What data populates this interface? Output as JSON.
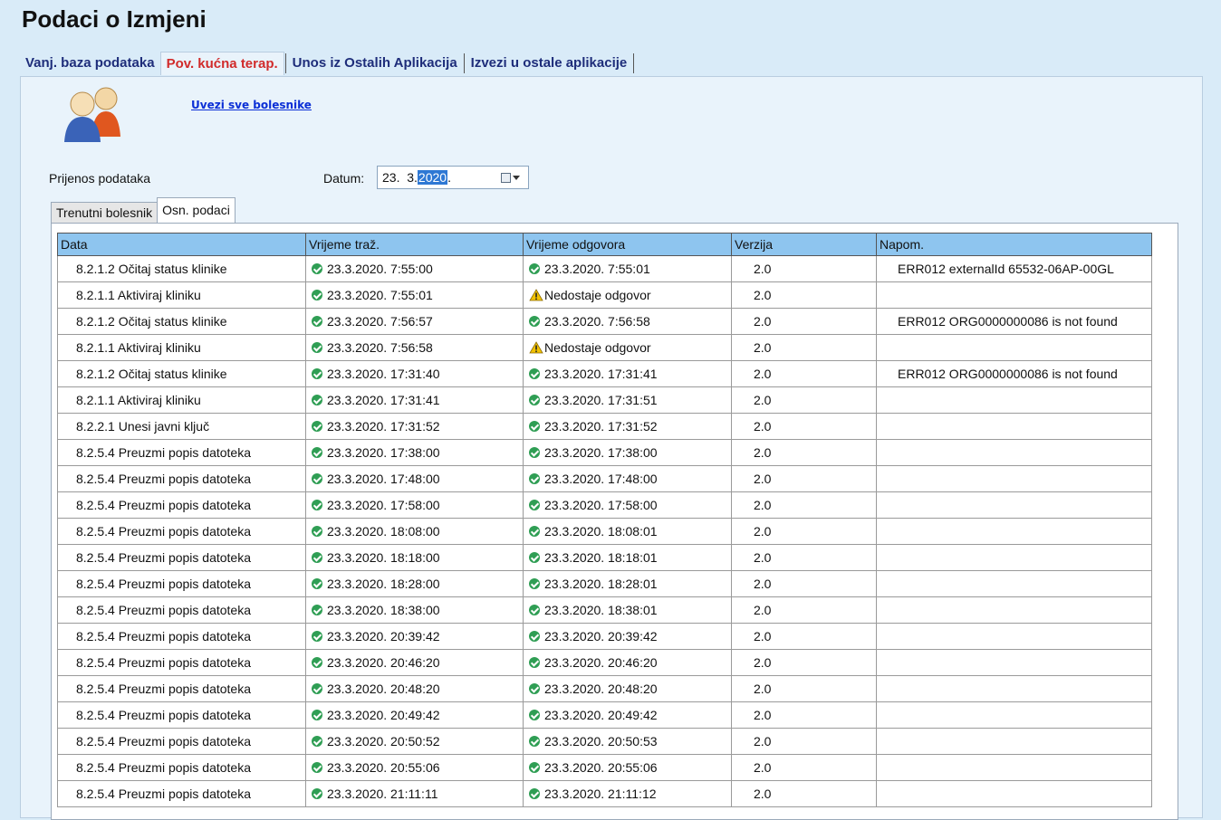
{
  "page": {
    "title": "Podaci o Izmjeni"
  },
  "main_tabs": [
    {
      "label": "Vanj. baza podataka",
      "active": false
    },
    {
      "label": "Pov. kućna terap.",
      "active": true
    },
    {
      "label": "Unos iz Ostalih Aplikacija",
      "active": false
    },
    {
      "label": "Izvezi u ostale aplikacije",
      "active": false
    }
  ],
  "panel": {
    "link_label": "Uvezi sve bolesnike",
    "transfer_label": "Prijenos podataka",
    "date_label": "Datum:",
    "date_value": {
      "day_month": "23.  3.",
      "year": "2020",
      "suffix": "."
    }
  },
  "sub_tabs": [
    {
      "label": "Trenutni bolesnik",
      "active": false
    },
    {
      "label": "Osn. podaci",
      "active": true
    }
  ],
  "grid": {
    "columns": [
      "Data",
      "Vrijeme traž.",
      "Vrijeme odgovora",
      "Verzija",
      "Napom."
    ],
    "rows": [
      {
        "data": "8.2.1.2 Očitaj status klinike",
        "req_time": "23.3.2020. 7:55:00",
        "resp_status": "ok",
        "resp_time": "23.3.2020. 7:55:01",
        "version": "2.0",
        "note": "ERR012 externalId 65532-06AP-00GL"
      },
      {
        "data": "8.2.1.1 Aktiviraj kliniku",
        "req_time": "23.3.2020. 7:55:01",
        "resp_status": "warn",
        "resp_time": "Nedostaje odgovor",
        "version": "2.0",
        "note": ""
      },
      {
        "data": "8.2.1.2 Očitaj status klinike",
        "req_time": "23.3.2020. 7:56:57",
        "resp_status": "ok",
        "resp_time": "23.3.2020. 7:56:58",
        "version": "2.0",
        "note": "ERR012 ORG0000000086 is not found"
      },
      {
        "data": "8.2.1.1 Aktiviraj kliniku",
        "req_time": "23.3.2020. 7:56:58",
        "resp_status": "warn",
        "resp_time": "Nedostaje odgovor",
        "version": "2.0",
        "note": ""
      },
      {
        "data": "8.2.1.2 Očitaj status klinike",
        "req_time": "23.3.2020. 17:31:40",
        "resp_status": "ok",
        "resp_time": "23.3.2020. 17:31:41",
        "version": "2.0",
        "note": "ERR012 ORG0000000086 is not found"
      },
      {
        "data": "8.2.1.1 Aktiviraj kliniku",
        "req_time": "23.3.2020. 17:31:41",
        "resp_status": "ok",
        "resp_time": "23.3.2020. 17:31:51",
        "version": "2.0",
        "note": ""
      },
      {
        "data": "8.2.2.1 Unesi javni ključ",
        "req_time": "23.3.2020. 17:31:52",
        "resp_status": "ok",
        "resp_time": "23.3.2020. 17:31:52",
        "version": "2.0",
        "note": ""
      },
      {
        "data": "8.2.5.4 Preuzmi popis datoteka",
        "req_time": "23.3.2020. 17:38:00",
        "resp_status": "ok",
        "resp_time": "23.3.2020. 17:38:00",
        "version": "2.0",
        "note": ""
      },
      {
        "data": "8.2.5.4 Preuzmi popis datoteka",
        "req_time": "23.3.2020. 17:48:00",
        "resp_status": "ok",
        "resp_time": "23.3.2020. 17:48:00",
        "version": "2.0",
        "note": ""
      },
      {
        "data": "8.2.5.4 Preuzmi popis datoteka",
        "req_time": "23.3.2020. 17:58:00",
        "resp_status": "ok",
        "resp_time": "23.3.2020. 17:58:00",
        "version": "2.0",
        "note": ""
      },
      {
        "data": "8.2.5.4 Preuzmi popis datoteka",
        "req_time": "23.3.2020. 18:08:00",
        "resp_status": "ok",
        "resp_time": "23.3.2020. 18:08:01",
        "version": "2.0",
        "note": ""
      },
      {
        "data": "8.2.5.4 Preuzmi popis datoteka",
        "req_time": "23.3.2020. 18:18:00",
        "resp_status": "ok",
        "resp_time": "23.3.2020. 18:18:01",
        "version": "2.0",
        "note": ""
      },
      {
        "data": "8.2.5.4 Preuzmi popis datoteka",
        "req_time": "23.3.2020. 18:28:00",
        "resp_status": "ok",
        "resp_time": "23.3.2020. 18:28:01",
        "version": "2.0",
        "note": ""
      },
      {
        "data": "8.2.5.4 Preuzmi popis datoteka",
        "req_time": "23.3.2020. 18:38:00",
        "resp_status": "ok",
        "resp_time": "23.3.2020. 18:38:01",
        "version": "2.0",
        "note": ""
      },
      {
        "data": "8.2.5.4 Preuzmi popis datoteka",
        "req_time": "23.3.2020. 20:39:42",
        "resp_status": "ok",
        "resp_time": "23.3.2020. 20:39:42",
        "version": "2.0",
        "note": ""
      },
      {
        "data": "8.2.5.4 Preuzmi popis datoteka",
        "req_time": "23.3.2020. 20:46:20",
        "resp_status": "ok",
        "resp_time": "23.3.2020. 20:46:20",
        "version": "2.0",
        "note": ""
      },
      {
        "data": "8.2.5.4 Preuzmi popis datoteka",
        "req_time": "23.3.2020. 20:48:20",
        "resp_status": "ok",
        "resp_time": "23.3.2020. 20:48:20",
        "version": "2.0",
        "note": ""
      },
      {
        "data": "8.2.5.4 Preuzmi popis datoteka",
        "req_time": "23.3.2020. 20:49:42",
        "resp_status": "ok",
        "resp_time": "23.3.2020. 20:49:42",
        "version": "2.0",
        "note": ""
      },
      {
        "data": "8.2.5.4 Preuzmi popis datoteka",
        "req_time": "23.3.2020. 20:50:52",
        "resp_status": "ok",
        "resp_time": "23.3.2020. 20:50:53",
        "version": "2.0",
        "note": ""
      },
      {
        "data": "8.2.5.4 Preuzmi popis datoteka",
        "req_time": "23.3.2020. 20:55:06",
        "resp_status": "ok",
        "resp_time": "23.3.2020. 20:55:06",
        "version": "2.0",
        "note": ""
      },
      {
        "data": "8.2.5.4 Preuzmi popis datoteka",
        "req_time": "23.3.2020. 21:11:11",
        "resp_status": "ok",
        "resp_time": "23.3.2020. 21:11:12",
        "version": "2.0",
        "note": ""
      }
    ]
  },
  "icons": {
    "avatar": "users-group-icon",
    "ok": "check-circle-icon",
    "warn": "warning-triangle-icon",
    "calendar": "calendar-dropdown-icon"
  },
  "colors": {
    "accent_active_tab": "#d12b2b",
    "tab_text": "#1e2d7a",
    "link": "#0b2fd6",
    "header_bg": "#8ec5ef",
    "status_ok": "#2f9e54",
    "status_warn": "#f2c200"
  }
}
